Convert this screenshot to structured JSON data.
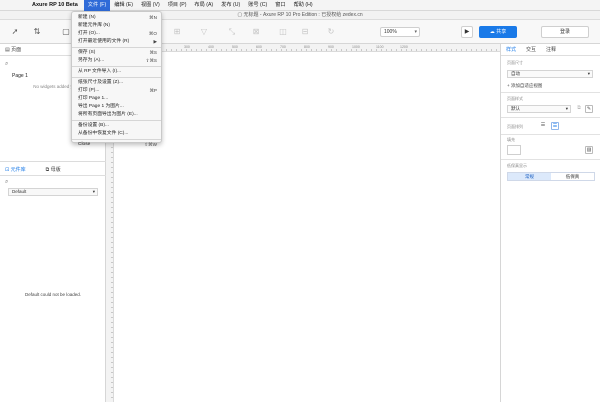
{
  "menubar": {
    "app_name": "Axure RP 10 Beta",
    "menus": [
      "文件 (F)",
      "编辑 (E)",
      "视图 (V)",
      "项目 (P)",
      "布局 (A)",
      "发布 (U)",
      "账号 (C)",
      "窗口",
      "帮助 (H)"
    ],
    "active_menu": "文件 (F)"
  },
  "window": {
    "title": "无标题 - Axure RP 10 Pro Edition : 已授权给 zedex.cn"
  },
  "toolbar": {
    "zoom": "100%",
    "share_label": "共享",
    "login_label": "登录"
  },
  "left_panel": {
    "pages_tab": "页面",
    "pages": [
      "Page 1"
    ],
    "no_widgets_text": "No widgets added y",
    "library_tab": "元件库",
    "masters_tab": "母版",
    "library_select": "Default",
    "library_message": "Default could not be loaded."
  },
  "canvas": {
    "ruler_labels": [
      "300",
      "400",
      "500",
      "600",
      "700",
      "800",
      "900",
      "1000",
      "1100",
      "1200"
    ]
  },
  "right_panel": {
    "tabs": [
      "样式",
      "交互",
      "注释"
    ],
    "page_size_label": "页面尺寸",
    "page_size_value": "自动",
    "add_adaptive": "+ 添加自适应视图",
    "page_style_label": "页面样式",
    "page_style_value": "默认",
    "page_align_label": "页面排列",
    "fill_label": "填充",
    "low_fi_label": "低保真显示",
    "fidelity_options": [
      "常规",
      "低保真"
    ]
  },
  "file_menu": {
    "items": [
      {
        "label": "新建 (N)",
        "shortcut": "⌘N",
        "disabled": false
      },
      {
        "label": "新建元件库 (N)",
        "shortcut": "",
        "disabled": false
      },
      {
        "label": "打开 (O)...",
        "shortcut": "⌘O",
        "disabled": false
      },
      {
        "label": "打开最近使用的文件 (R)",
        "shortcut": "▶",
        "disabled": false
      },
      {
        "sep": true
      },
      {
        "label": "保存 (S)",
        "shortcut": "⌘S",
        "disabled": false
      },
      {
        "label": "另存为 (A)...",
        "shortcut": "⇧⌘S",
        "disabled": false
      },
      {
        "sep": true
      },
      {
        "label": "从 RP 文件导入 (I)...",
        "shortcut": "",
        "disabled": false
      },
      {
        "sep": true
      },
      {
        "label": "纸张尺寸及设置 (Z)...",
        "shortcut": "",
        "disabled": false
      },
      {
        "label": "打印 (P)...",
        "shortcut": "⌘P",
        "disabled": false
      },
      {
        "label": "打印 Page 1...",
        "shortcut": "",
        "disabled": false
      },
      {
        "label": "导出 Page 1 为图片...",
        "shortcut": "",
        "disabled": false
      },
      {
        "label": "将所有页面导出为图片 (E)...",
        "shortcut": "",
        "disabled": false
      },
      {
        "sep": true
      },
      {
        "label": "备份设置 (B)...",
        "shortcut": "",
        "disabled": false
      },
      {
        "label": "从备份中恢复文件 (C)...",
        "shortcut": "",
        "disabled": false
      },
      {
        "sep": true
      },
      {
        "label": "Close",
        "shortcut": "⇧⌘W",
        "disabled": false
      }
    ]
  }
}
